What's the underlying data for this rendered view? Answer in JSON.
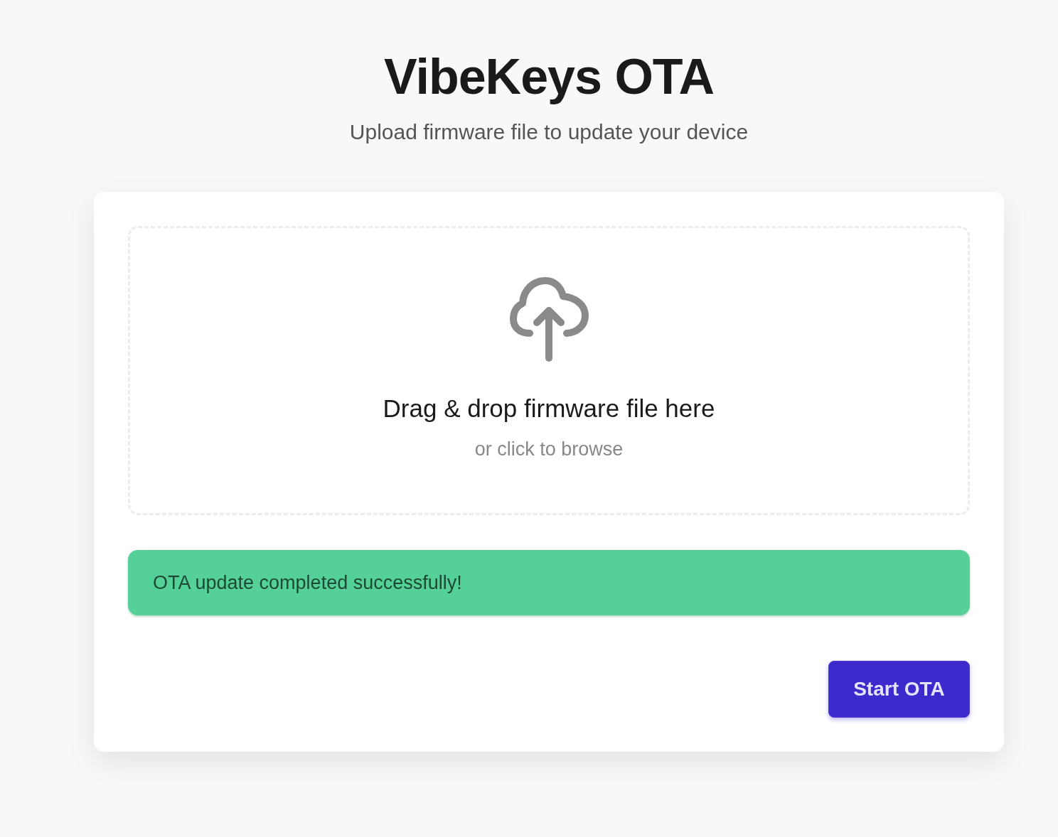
{
  "header": {
    "title": "VibeKeys OTA",
    "subtitle": "Upload firmware file to update your device"
  },
  "dropzone": {
    "title": "Drag & drop firmware file here",
    "hint": "or click to browse"
  },
  "status": {
    "kind": "success",
    "message": "OTA update completed successfully!"
  },
  "actions": {
    "primary": "Start OTA"
  }
}
